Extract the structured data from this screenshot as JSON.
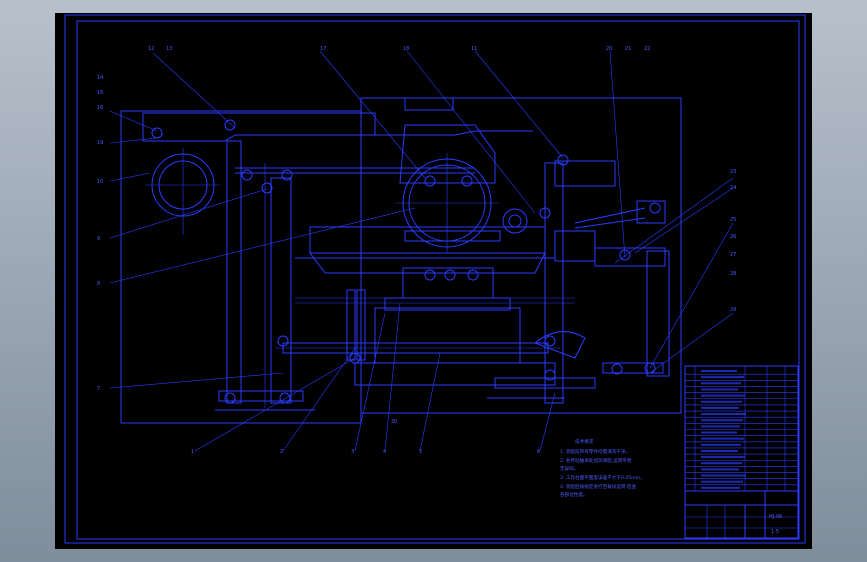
{
  "colors": {
    "background": "#000000",
    "lines": "#2a3cff",
    "outside": "#8e9aa8"
  },
  "balloons": {
    "top_left": [
      "12",
      "13"
    ],
    "top_mid": [
      "17",
      "18"
    ],
    "top_right": [
      "11",
      "20",
      "21",
      "22"
    ],
    "left": [
      "14",
      "15",
      "16",
      "19",
      "10",
      "9",
      "8",
      "7"
    ],
    "right": [
      "23",
      "24",
      "25",
      "26",
      "27",
      "28",
      "29"
    ],
    "bottom": [
      "1",
      "2",
      "3",
      "4",
      "5",
      "6",
      "30"
    ]
  },
  "notes": {
    "title": "技术要求",
    "lines": [
      "1. 装配前所有零件均需清洗干净。",
      "2. 各传动轴承处加润滑脂,运转平稳",
      "   无异响。",
      "3. 工作台面平面度误差不大于0.05mm。",
      "4. 装配后按规定进行空载试运转,检查",
      "   各部位性能。"
    ]
  },
  "title_block": {
    "drawing_no": "HJ-06",
    "scale": "1:5"
  }
}
